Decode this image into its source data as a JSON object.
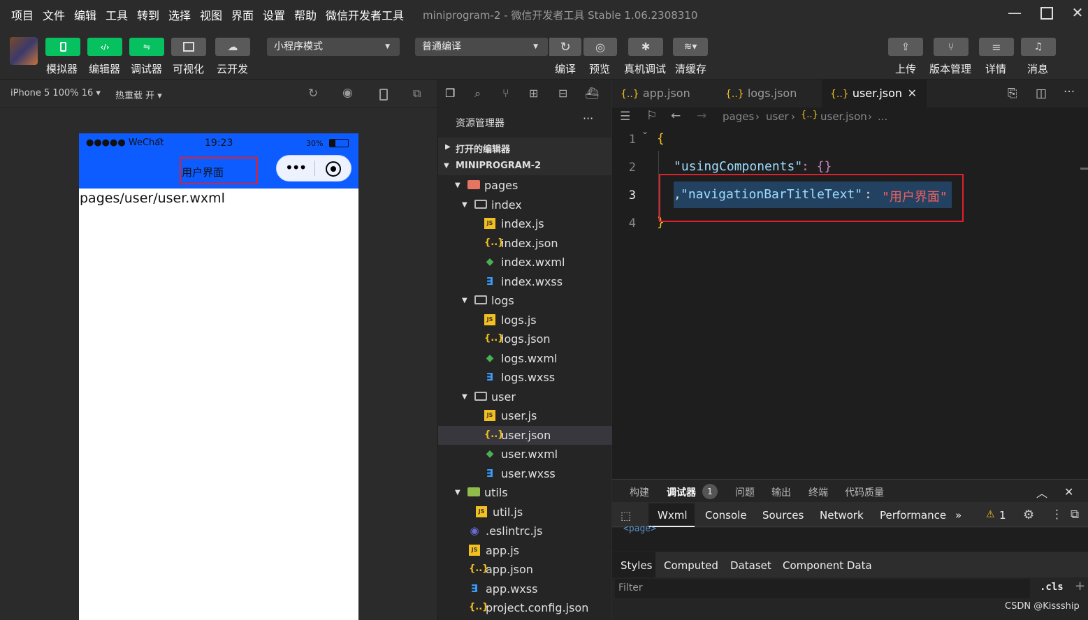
{
  "menu": [
    "项目",
    "文件",
    "编辑",
    "工具",
    "转到",
    "选择",
    "视图",
    "界面",
    "设置",
    "帮助",
    "微信开发者工具"
  ],
  "window_title": "miniprogram-2 - 微信开发者工具 Stable 1.06.2308310",
  "toolbar": {
    "left_buttons": [
      "模拟器",
      "编辑器",
      "调试器",
      "可视化",
      "云开发"
    ],
    "mode_select": "小程序模式",
    "compile_select": "普通编译",
    "mid_buttons": [
      "编译",
      "预览",
      "真机调试",
      "清缓存"
    ],
    "right_buttons": [
      "上传",
      "版本管理",
      "详情",
      "消息"
    ]
  },
  "simulator": {
    "device": "iPhone 5 100% 16 ▾",
    "hot_reload": "热重载 开 ▾",
    "status_carrier": "●●●●● WeChat",
    "status_time": "19:23",
    "status_battery": "30%",
    "nav_title": "用户界面",
    "page_text": "pages/user/user.wxml"
  },
  "explorer": {
    "title": "资源管理器",
    "open_editors": "打开的编辑器",
    "project": "MINIPROGRAM-2",
    "tree": [
      {
        "label": "pages",
        "type": "folder-red",
        "depth": 1,
        "arrow": "▾"
      },
      {
        "label": "index",
        "type": "folder",
        "depth": 2,
        "arrow": "▾"
      },
      {
        "label": "index.js",
        "type": "js",
        "depth": 3
      },
      {
        "label": "index.json",
        "type": "json",
        "depth": 3
      },
      {
        "label": "index.wxml",
        "type": "wxml",
        "depth": 3
      },
      {
        "label": "index.wxss",
        "type": "wxss",
        "depth": 3
      },
      {
        "label": "logs",
        "type": "folder",
        "depth": 2,
        "arrow": "▾"
      },
      {
        "label": "logs.js",
        "type": "js",
        "depth": 3
      },
      {
        "label": "logs.json",
        "type": "json",
        "depth": 3
      },
      {
        "label": "logs.wxml",
        "type": "wxml",
        "depth": 3
      },
      {
        "label": "logs.wxss",
        "type": "wxss",
        "depth": 3
      },
      {
        "label": "user",
        "type": "folder",
        "depth": 2,
        "arrow": "▾"
      },
      {
        "label": "user.js",
        "type": "js",
        "depth": 3
      },
      {
        "label": "user.json",
        "type": "json",
        "depth": 3,
        "selected": true
      },
      {
        "label": "user.wxml",
        "type": "wxml",
        "depth": 3
      },
      {
        "label": "user.wxss",
        "type": "wxss",
        "depth": 3
      },
      {
        "label": "utils",
        "type": "folder-green",
        "depth": 1,
        "arrow": "▾"
      },
      {
        "label": "util.js",
        "type": "js",
        "depth": 2
      },
      {
        "label": ".eslintrc.js",
        "type": "eslint",
        "depth": 1
      },
      {
        "label": "app.js",
        "type": "js",
        "depth": 1
      },
      {
        "label": "app.json",
        "type": "json",
        "depth": 1
      },
      {
        "label": "app.wxss",
        "type": "wxss",
        "depth": 1
      },
      {
        "label": "project.config.json",
        "type": "json",
        "depth": 1
      }
    ]
  },
  "editor": {
    "tabs": [
      "app.json",
      "logs.json",
      "user.json"
    ],
    "breadcrumb": [
      "pages",
      "user",
      "user.json",
      "..."
    ],
    "lines": {
      "l1": "{",
      "l2_key": "\"usingComponents\"",
      "l2_rest": ": {}",
      "l3_comma": ",",
      "l3_key": "\"navigationBarTitleText\"",
      "l3_colon": ": ",
      "l3_val": "\"用户界面\"",
      "l4": "}"
    },
    "line_numbers": [
      "1",
      "2",
      "3",
      "4"
    ]
  },
  "panel": {
    "tabs": [
      "构建",
      "调试器",
      "问题",
      "输出",
      "终端",
      "代码质量"
    ],
    "debugger_badge": "1",
    "devtools_tabs": [
      "Wxml",
      "Console",
      "Sources",
      "Network",
      "Performance"
    ],
    "more": "»",
    "warning_count": "1",
    "dom_text": "<page>",
    "style_tabs": [
      "Styles",
      "Computed",
      "Dataset",
      "Component Data"
    ],
    "filter_placeholder": "Filter",
    "cls": ".cls",
    "plus": "+"
  },
  "watermark": "CSDN @Kissship",
  "colors": {
    "accent_green": "#07c160",
    "nav_blue": "#0d5cff",
    "highlight_red": "#e0202a"
  }
}
